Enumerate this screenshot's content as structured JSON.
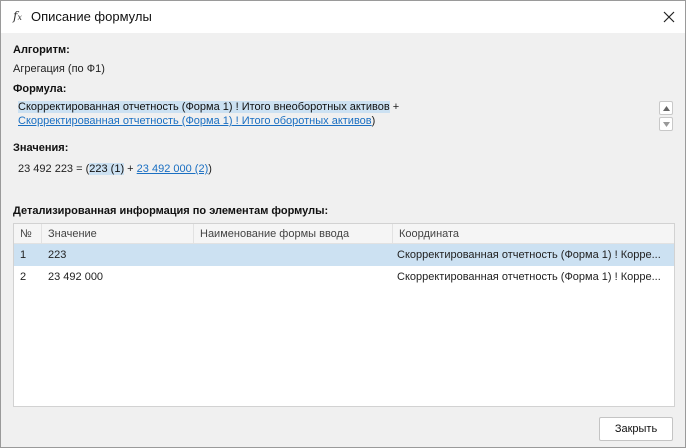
{
  "window": {
    "title": "Описание формулы",
    "icon": "function-icon"
  },
  "algorithm": {
    "label": "Алгоритм:",
    "value": "Агрегация (по Ф1)"
  },
  "formula": {
    "label": "Формула:",
    "line1_term": "Скорректированная отчетность (Форма 1) ! Итого внеоборотных активов",
    "line1_op": " +",
    "line2_link": "Скорректированная отчетность (Форма 1) ! Итого оборотных активов",
    "line2_close": ")"
  },
  "values": {
    "label": "Значения:",
    "result": "23 492 223 = (",
    "term1": "223 (1)",
    "plus": " + ",
    "term2_link": "23 492 000 (2)",
    "close": ")"
  },
  "details": {
    "label": "Детализированная информация по элементам формулы:",
    "columns": [
      "№",
      "Значение",
      "Наименование формы ввода",
      "Координата"
    ],
    "rows": [
      {
        "num": "1",
        "value": "223",
        "form": "",
        "coord": "Скорректированная отчетность (Форма 1) ! Корре...",
        "selected": true
      },
      {
        "num": "2",
        "value": "23 492 000",
        "form": "",
        "coord": "Скорректированная отчетность (Форма 1) ! Корре...",
        "selected": false
      }
    ]
  },
  "buttons": {
    "close": "Закрыть"
  },
  "colors": {
    "selection": "#cce1f2",
    "link": "#1a6fc2",
    "background": "#f0f0f0"
  }
}
